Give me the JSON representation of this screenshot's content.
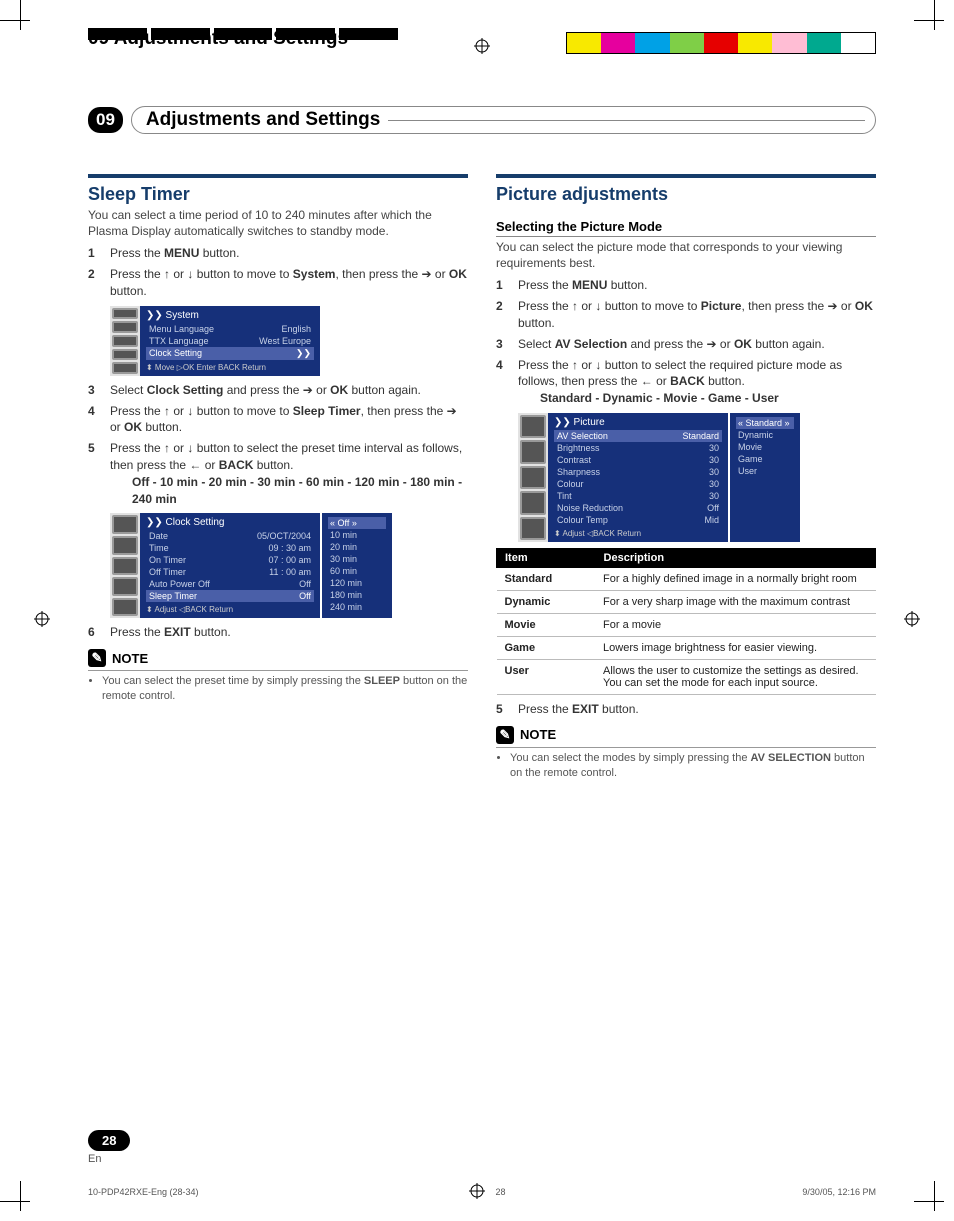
{
  "header": {
    "running": "09 Adjustments and Settings",
    "chapter_num": "09",
    "chapter_title": "Adjustments and Settings"
  },
  "color_bars": [
    "#f8e900",
    "#e6009e",
    "#00a1e6",
    "#7fcf47",
    "#e60000",
    "#f8e900",
    "#ffbdd4",
    "#00a98f",
    "#ffffff"
  ],
  "left": {
    "title": "Sleep Timer",
    "intro": "You can select a time period of 10 to 240 minutes after which the Plasma Display automatically switches to standby mode.",
    "steps": [
      {
        "n": "1",
        "t": "Press the ",
        "b": "MENU",
        "t2": " button."
      },
      {
        "n": "2",
        "t": "Press the ↑ or ↓ button to move to ",
        "b": "System",
        "t2": ", then press the ➔ or ",
        "b2": "OK",
        "t3": " button."
      },
      {
        "n": "3",
        "t": "Select ",
        "b": "Clock Setting",
        "t2": " and press the ➔ or ",
        "b2": "OK",
        "t3": " button again."
      },
      {
        "n": "4",
        "t": "Press the ↑ or ↓ button to move to ",
        "b": "Sleep Timer",
        "t2": ", then press the ➔ or ",
        "b2": "OK",
        "t3": " button."
      },
      {
        "n": "5",
        "t": "Press the ↑ or ↓ button to select the preset time interval as follows, then press the ← or ",
        "b": "BACK",
        "t2": " button.",
        "extra": "Off - 10 min - 20 min - 30 min - 60 min - 120 min - 180 min - 240 min"
      },
      {
        "n": "6",
        "t": "Press the ",
        "b": "EXIT",
        "t2": " button."
      }
    ],
    "osd1": {
      "head": "System",
      "rows": [
        [
          "Menu Language",
          "English"
        ],
        [
          "TTX Language",
          "West Europe"
        ],
        [
          "Clock Setting",
          "❯❯"
        ]
      ],
      "foot": "⬍ Move   ▷OK Enter   BACK Return"
    },
    "osd2": {
      "head": "Clock Setting",
      "rows": [
        [
          "Date",
          "05/OCT/2004"
        ],
        [
          "Time",
          "09 : 30 am"
        ],
        [
          "On Timer",
          "07 : 00 am"
        ],
        [
          "Off Timer",
          "11 : 00 am"
        ],
        [
          "Auto Power Off",
          "Off"
        ],
        [
          "Sleep Timer",
          "Off"
        ]
      ],
      "side": [
        "Off",
        "10 min",
        "20 min",
        "30 min",
        "60 min",
        "120 min",
        "180 min",
        "240 min"
      ],
      "foot": "⬍ Adjust   ◁BACK Return"
    },
    "note_label": "NOTE",
    "note": "You can select the preset time by simply pressing the ",
    "note_b": "SLEEP",
    "note2": " button on the remote control."
  },
  "right": {
    "title": "Picture adjustments",
    "sub": "Selecting the Picture Mode",
    "intro": "You can select the picture mode that corresponds to your viewing requirements best.",
    "steps": [
      {
        "n": "1",
        "t": "Press the ",
        "b": "MENU",
        "t2": " button."
      },
      {
        "n": "2",
        "t": "Press the ↑ or ↓ button to move to ",
        "b": "Picture",
        "t2": ", then press the ➔ or ",
        "b2": "OK",
        "t3": " button."
      },
      {
        "n": "3",
        "t": "Select ",
        "b": "AV Selection",
        "t2": " and press the ➔ or ",
        "b2": "OK",
        "t3": " button again."
      },
      {
        "n": "4",
        "t": "Press the ↑ or ↓ button to select the required picture mode as follows, then press the ← or ",
        "b": "BACK",
        "t2": " button.",
        "extra": "Standard - Dynamic - Movie - Game - User"
      },
      {
        "n": "5",
        "t": "Press the ",
        "b": "EXIT",
        "t2": " button."
      }
    ],
    "osd": {
      "head": "Picture",
      "rows": [
        [
          "AV Selection",
          "Standard"
        ],
        [
          "Brightness",
          "30"
        ],
        [
          "Contrast",
          "30"
        ],
        [
          "Sharpness",
          "30"
        ],
        [
          "Colour",
          "30"
        ],
        [
          "Tint",
          "30"
        ],
        [
          "Noise Reduction",
          "Off"
        ],
        [
          "Colour Temp",
          "Mid"
        ]
      ],
      "side": [
        "Standard",
        "Dynamic",
        "Movie",
        "Game",
        "User"
      ],
      "foot": "⬍ Adjust   ◁BACK Return"
    },
    "table": {
      "head": [
        "Item",
        "Description"
      ],
      "rows": [
        [
          "Standard",
          "For a highly defined image in a normally bright room"
        ],
        [
          "Dynamic",
          "For a very sharp image with the maximum contrast"
        ],
        [
          "Movie",
          "For a movie"
        ],
        [
          "Game",
          "Lowers image brightness for easier viewing."
        ],
        [
          "User",
          "Allows the user to customize the settings as desired. You can set the mode for each input source."
        ]
      ]
    },
    "note_label": "NOTE",
    "note": "You can select the modes by simply pressing the ",
    "note_b": "AV SELECTION",
    "note2": " button on the remote control."
  },
  "footer": {
    "page": "28",
    "lang": "En",
    "printleft": "10-PDP42RXE-Eng (28-34)",
    "printmid": "28",
    "printright": "9/30/05, 12:16 PM"
  }
}
